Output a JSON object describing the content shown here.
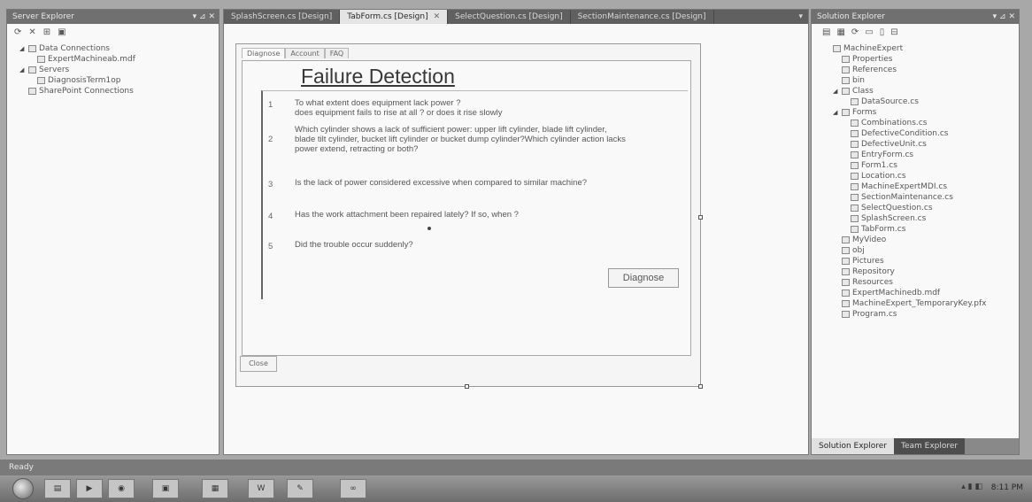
{
  "server_explorer": {
    "title": "Server Explorer",
    "nodes": [
      {
        "label": "Data Connections",
        "indent": 1,
        "expander": "expanded"
      },
      {
        "label": "ExpertMachineab.mdf",
        "indent": 2,
        "expander": "none"
      },
      {
        "label": "Servers",
        "indent": 1,
        "expander": "expanded"
      },
      {
        "label": "DiagnosisTerm1op",
        "indent": 2,
        "expander": "none"
      },
      {
        "label": "SharePoint Connections",
        "indent": 1,
        "expander": "none"
      }
    ]
  },
  "designer": {
    "tabs": [
      {
        "label": "SplashScreen.cs [Design]",
        "active": false
      },
      {
        "label": "TabForm.cs [Design]",
        "active": true
      },
      {
        "label": "SelectQuestion.cs [Design]",
        "active": false
      },
      {
        "label": "SectionMaintenance.cs [Design]",
        "active": false
      }
    ],
    "form": {
      "tabs": [
        "Diagnose",
        "Account",
        "FAQ"
      ],
      "title": "Failure Detection",
      "questions": [
        {
          "num": "1",
          "lines": [
            "To what extent does equipment lack power ?",
            "does equipment fails to rise at all ? or does it rise slowly"
          ]
        },
        {
          "num": "2",
          "lines": [
            "Which cylinder shows a lack of sufficient power: upper lift cylinder, blade lift cylinder,",
            "blade tilt cylinder, bucket lift cylinder or bucket dump cylinder?Which cylinder action lacks",
            "power extend, retracting or both?"
          ]
        },
        {
          "num": "3",
          "lines": [
            "Is the lack of power considered excessive when compared to similar machine?"
          ]
        },
        {
          "num": "4",
          "lines": [
            "Has the work attachment been repaired lately? If so, when ?"
          ]
        },
        {
          "num": "5",
          "lines": [
            "Did the trouble occur suddenly?"
          ]
        }
      ],
      "diagnose_button": "Diagnose",
      "close_button": "Close"
    }
  },
  "solution_explorer": {
    "title": "Solution Explorer",
    "nodes": [
      {
        "label": "MachineExpert",
        "indent": 1,
        "expander": "none"
      },
      {
        "label": "Properties",
        "indent": 2,
        "expander": "none"
      },
      {
        "label": "References",
        "indent": 2,
        "expander": "none"
      },
      {
        "label": "bin",
        "indent": 2,
        "expander": "none"
      },
      {
        "label": "Class",
        "indent": 2,
        "expander": "expanded"
      },
      {
        "label": "DataSource.cs",
        "indent": 3,
        "expander": "none"
      },
      {
        "label": "Forms",
        "indent": 2,
        "expander": "expanded"
      },
      {
        "label": "Combinations.cs",
        "indent": 3,
        "expander": "none"
      },
      {
        "label": "DefectiveCondition.cs",
        "indent": 3,
        "expander": "none"
      },
      {
        "label": "DefectiveUnit.cs",
        "indent": 3,
        "expander": "none"
      },
      {
        "label": "EntryForm.cs",
        "indent": 3,
        "expander": "none"
      },
      {
        "label": "Form1.cs",
        "indent": 3,
        "expander": "none"
      },
      {
        "label": "Location.cs",
        "indent": 3,
        "expander": "none"
      },
      {
        "label": "MachineExpertMDI.cs",
        "indent": 3,
        "expander": "none"
      },
      {
        "label": "SectionMaintenance.cs",
        "indent": 3,
        "expander": "none"
      },
      {
        "label": "SelectQuestion.cs",
        "indent": 3,
        "expander": "none"
      },
      {
        "label": "SplashScreen.cs",
        "indent": 3,
        "expander": "none"
      },
      {
        "label": "TabForm.cs",
        "indent": 3,
        "expander": "none"
      },
      {
        "label": "MyVideo",
        "indent": 2,
        "expander": "none"
      },
      {
        "label": "obj",
        "indent": 2,
        "expander": "none"
      },
      {
        "label": "Pictures",
        "indent": 2,
        "expander": "none"
      },
      {
        "label": "Repository",
        "indent": 2,
        "expander": "none"
      },
      {
        "label": "Resources",
        "indent": 2,
        "expander": "none"
      },
      {
        "label": "ExpertMachinedb.mdf",
        "indent": 2,
        "expander": "none"
      },
      {
        "label": "MachineExpert_TemporaryKey.pfx",
        "indent": 2,
        "expander": "none"
      },
      {
        "label": "Program.cs",
        "indent": 2,
        "expander": "none"
      }
    ],
    "bottom_tabs": [
      {
        "label": "Solution Explorer",
        "active": true
      },
      {
        "label": "Team Explorer",
        "active": false
      }
    ]
  },
  "status_bar": {
    "text": "Ready"
  },
  "taskbar": {
    "clock": "8:11 PM"
  },
  "colors": {
    "window_bg": "#a8a8a8",
    "titlebar": "#6f6f6f",
    "pane_bg": "#ffffff"
  }
}
